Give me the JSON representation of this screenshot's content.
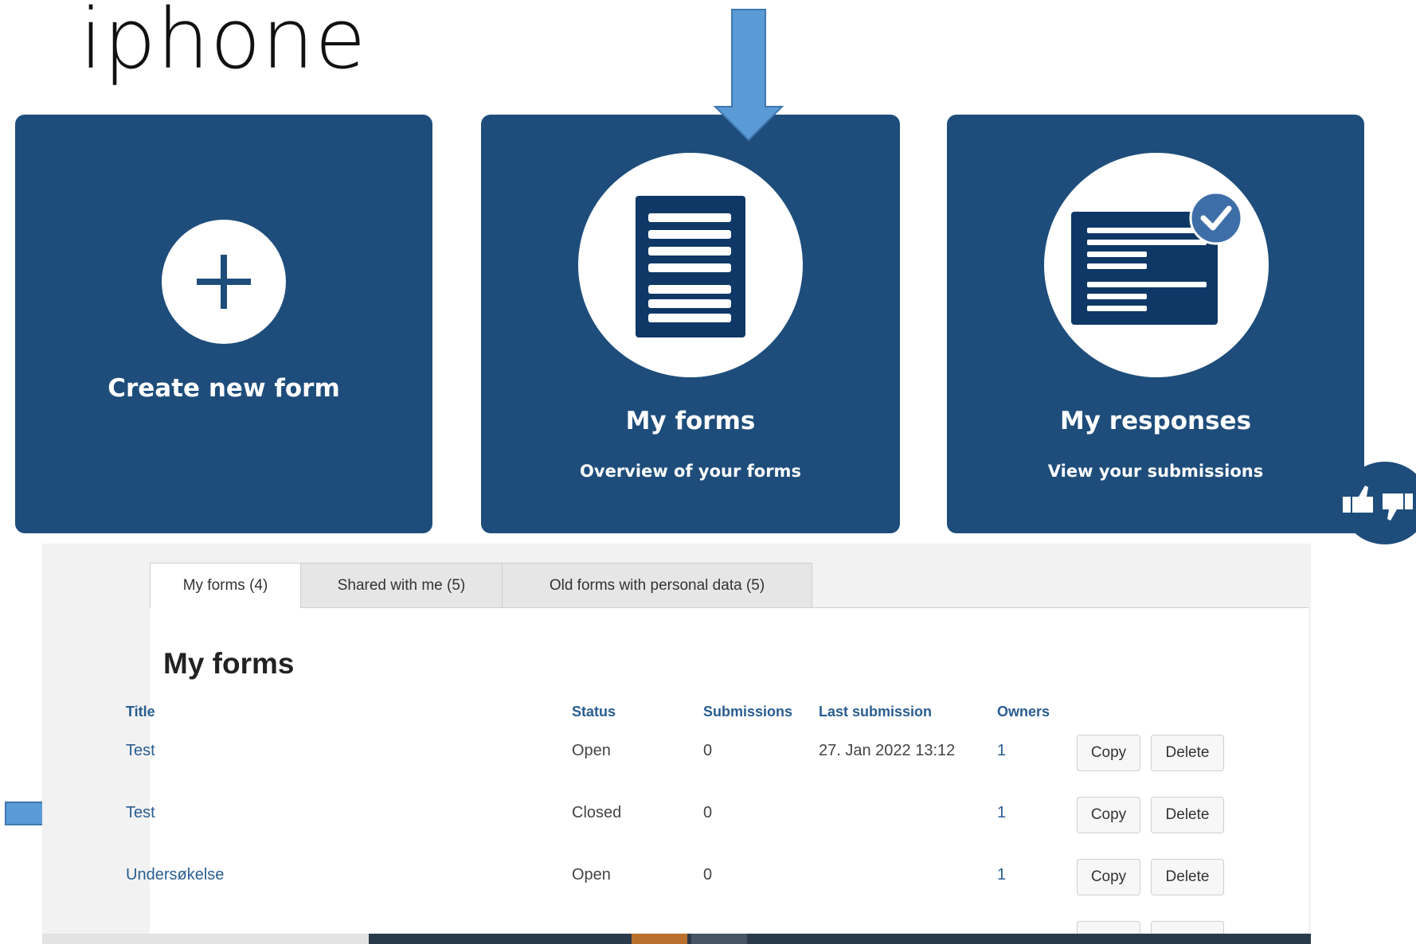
{
  "slide": {
    "title": "iphone"
  },
  "cards": {
    "create": {
      "label": "Create new form",
      "icon": "plus-icon"
    },
    "my_forms": {
      "label": "My forms",
      "subtitle": "Overview of your forms",
      "icon": "document-icon"
    },
    "my_responses": {
      "label": "My responses",
      "subtitle": "View your submissions",
      "icon": "submitted-document-icon"
    }
  },
  "feedback": {
    "icon": "thumbs-feedback-icon"
  },
  "tabs": [
    {
      "label": "My forms (4)",
      "active": true
    },
    {
      "label": "Shared with me (5)",
      "active": false
    },
    {
      "label": "Old forms with personal data (5)",
      "active": false
    }
  ],
  "forms": {
    "heading": "My forms",
    "columns": [
      "Title",
      "Status",
      "Submissions",
      "Last submission",
      "Owners"
    ],
    "copy_label": "Copy",
    "delete_label": "Delete",
    "rows": [
      {
        "title": "Test",
        "status": "Open",
        "submissions": "0",
        "last_submission": "27. Jan 2022 13:12",
        "owners": "1"
      },
      {
        "title": "Test",
        "status": "Closed",
        "submissions": "0",
        "last_submission": "",
        "owners": "1"
      },
      {
        "title": "Undersøkelse",
        "status": "Open",
        "submissions": "0",
        "last_submission": "",
        "owners": "1"
      }
    ]
  },
  "colors": {
    "card": "#1e4d7b",
    "arrow": "#5b9bd5",
    "link": "#2a5d91"
  }
}
